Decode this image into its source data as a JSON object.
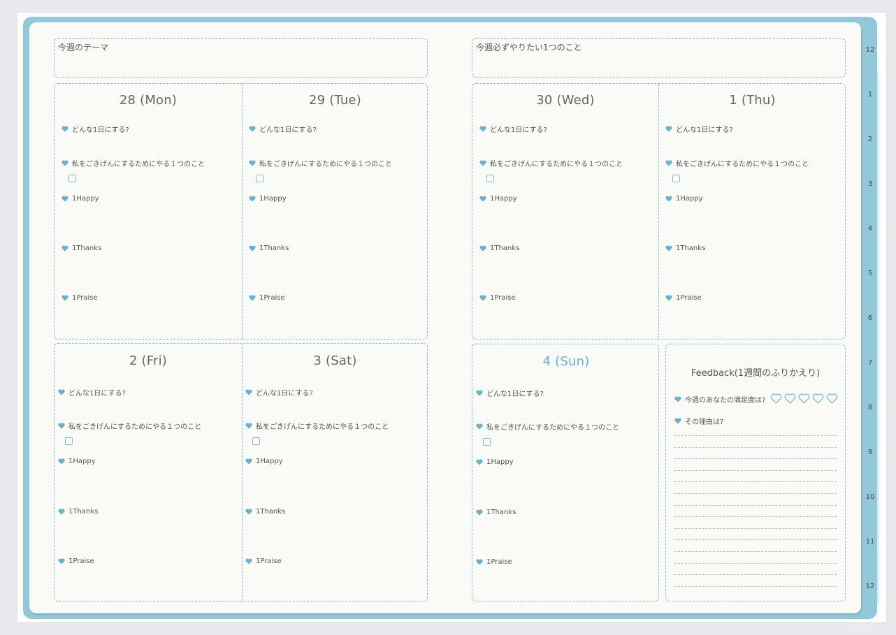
{
  "header": {
    "theme_label": "今週のテーマ",
    "one_thing_label": "今週必ずやりたい1つのこと"
  },
  "days": [
    {
      "title": "28 (Mon)"
    },
    {
      "title": "29 (Tue)"
    },
    {
      "title": "30 (Wed)"
    },
    {
      "title": "1 (Thu)"
    },
    {
      "title": "2 (Fri)"
    },
    {
      "title": "3 (Sat)"
    },
    {
      "title": "4 (Sun)"
    }
  ],
  "prompts": {
    "how_day": "どんな1日にする?",
    "gokigen": "私をごきげんにするためにやる１つのこと",
    "happy": "1Happy",
    "thanks": "1Thanks",
    "praise": "1Praise"
  },
  "feedback": {
    "title": "Feedback(1週間のふりかえり)",
    "satisfaction": "今週のあなたの満足度は?",
    "reason": "その理由は?",
    "rating": 0,
    "rating_max": 5
  },
  "month_tabs": [
    "12",
    "1",
    "2",
    "3",
    "4",
    "5",
    "6",
    "7",
    "8",
    "9",
    "10",
    "11",
    "12"
  ],
  "colors": {
    "accent": "#93c8d9",
    "heart": "#67b2cc",
    "sunday": "#67b2cc"
  }
}
